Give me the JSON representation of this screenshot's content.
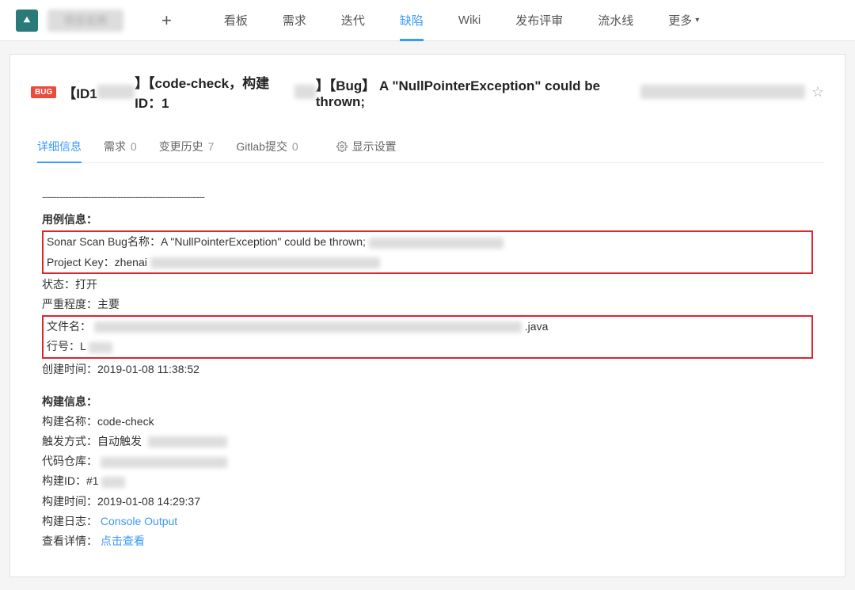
{
  "topbar": {
    "logo_text": "健康",
    "nav": [
      {
        "label": "看板",
        "active": false
      },
      {
        "label": "需求",
        "active": false
      },
      {
        "label": "迭代",
        "active": false
      },
      {
        "label": "缺陷",
        "active": true
      },
      {
        "label": "Wiki",
        "active": false
      },
      {
        "label": "发布评审",
        "active": false
      },
      {
        "label": "流水线",
        "active": false
      },
      {
        "label": "更多",
        "active": false,
        "more": true
      }
    ]
  },
  "header": {
    "bug_badge": "BUG",
    "title_prefix": "【ID1",
    "title_mid1": "】【code-check，构建ID：1",
    "title_mid2": "】【Bug】 A \"NullPointerException\" could be thrown; "
  },
  "tabs": [
    {
      "label": "详细信息",
      "count": "",
      "active": true
    },
    {
      "label": "需求",
      "count": "0",
      "active": false
    },
    {
      "label": "变更历史",
      "count": "7",
      "active": false
    },
    {
      "label": "Gitlab提交",
      "count": "0",
      "active": false
    }
  ],
  "display_settings": "显示设置",
  "details": {
    "separator": "--------------------------------------------------------",
    "usecase_title": "用例信息：",
    "sonar_bug_label": "Sonar Scan Bug名称：A \"NullPointerException\" could be thrown; ",
    "project_key_label": "Project Key：zhenai ",
    "status": "状态：打开",
    "severity": "严重程度：主要",
    "file_name_label": "文件名：",
    "file_ext": ".java",
    "line_label": "行号：L",
    "create_time": "创建时间：2019-01-08 11:38:52",
    "build_title": "构建信息：",
    "build_name": "构建名称：code-check",
    "trigger": "触发方式：自动触发",
    "repo_label": "代码仓库：",
    "build_id_label": "构建ID：#1",
    "build_time": "构建时间：2019-01-08 14:29:37",
    "build_log_label": "构建日志：",
    "build_log_link": "Console Output",
    "view_detail_label": "查看详情：",
    "view_detail_link": "点击查看"
  }
}
